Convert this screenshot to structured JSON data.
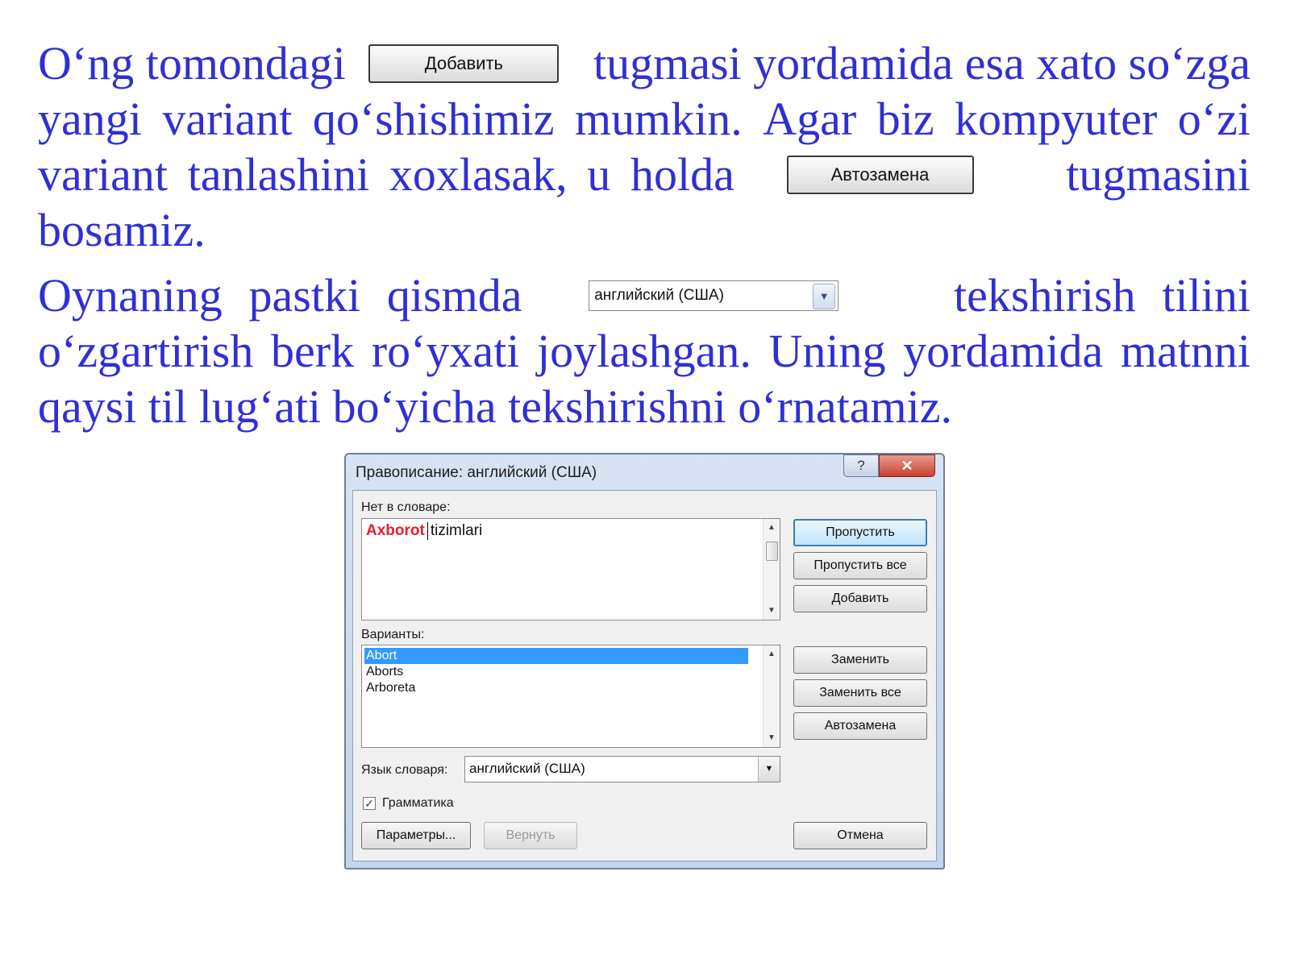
{
  "paragraph1": {
    "line1_left": "O‘ng tomondagi",
    "add_button_label": "Добавить",
    "line1_right": "tugmasi yordamida esa xato so‘zga",
    "line2_words": [
      "yangi",
      "variant",
      "qo‘shishimiz",
      "mumkin.",
      "Agar",
      "biz",
      "kompyuter",
      "o‘zi"
    ],
    "line3_left_words": [
      "variant",
      "tanlashini",
      "xoxlasak,",
      "u",
      "holda"
    ],
    "autocorrect_button_label": "Автозамена",
    "line3_right": "tugmasini",
    "line4": "bosamiz."
  },
  "paragraph2": {
    "line1_left_words": [
      "Oynaning",
      "pastki",
      "qismda"
    ],
    "language_select_value": "английский (США)",
    "line1_right_words": [
      "tekshirish",
      "tilini"
    ],
    "line2_words": [
      "o‘zgartirish",
      "berk",
      "ro‘yxati",
      "joylashgan.",
      "Uning",
      "yordamida",
      "matnni"
    ],
    "line3": "qaysi til lug‘ati bo‘yicha tekshirishni o‘rnatamiz."
  },
  "dialog": {
    "title": "Правописание: английский (США)",
    "help_glyph": "?",
    "close_glyph": "✕",
    "not_in_dict_label": "Нет в словаре:",
    "error_word": "Axborot",
    "rest_text": "tizimlari",
    "suggestions_label": "Варианты:",
    "suggestions": [
      "Abort",
      "Aborts",
      "Arboreta"
    ],
    "dict_language_label": "Язык словаря:",
    "dict_language_value": "английский (США)",
    "grammar_label": "Грамматика",
    "grammar_checked": true,
    "buttons": {
      "ignore": "Пропустить",
      "ignore_all": "Пропустить все",
      "add": "Добавить",
      "change": "Заменить",
      "change_all": "Заменить все",
      "autocorrect": "Автозамена",
      "options": "Параметры...",
      "undo": "Вернуть",
      "cancel": "Отмена"
    }
  },
  "colors": {
    "text_blue": "#2f2fd6",
    "error_red": "#e0202a",
    "selection_blue": "#3399ff"
  }
}
